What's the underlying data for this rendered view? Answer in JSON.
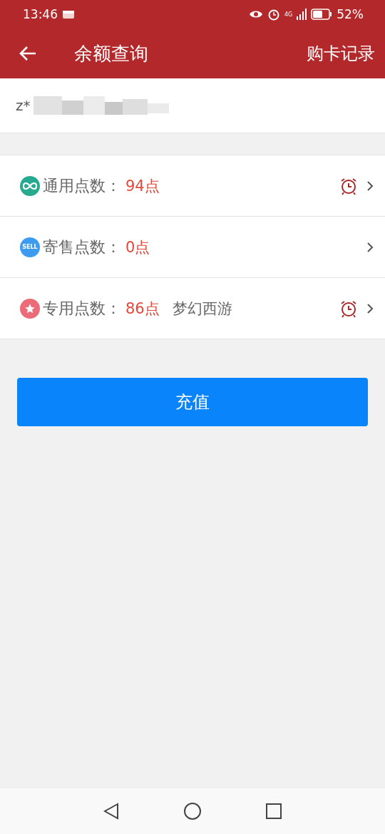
{
  "status_bar": {
    "time": "13:46",
    "network": "4G",
    "battery": "52%"
  },
  "app_bar": {
    "title": "余额查询",
    "action": "购卡记录"
  },
  "account": {
    "masked_prefix": "z*"
  },
  "balances": [
    {
      "kind": "infinity",
      "color": "#26a98f",
      "label": "通用点数：",
      "value": "94点",
      "alarm": true
    },
    {
      "kind": "sell",
      "color": "#3d9cf0",
      "badge": "SELL",
      "label": "寄售点数：",
      "value": "0点",
      "alarm": false
    },
    {
      "kind": "star",
      "color": "#ec6b78",
      "label": "专用点数：",
      "value": "86点",
      "game": "梦幻西游",
      "alarm": true
    }
  ],
  "recharge_button": "充值"
}
